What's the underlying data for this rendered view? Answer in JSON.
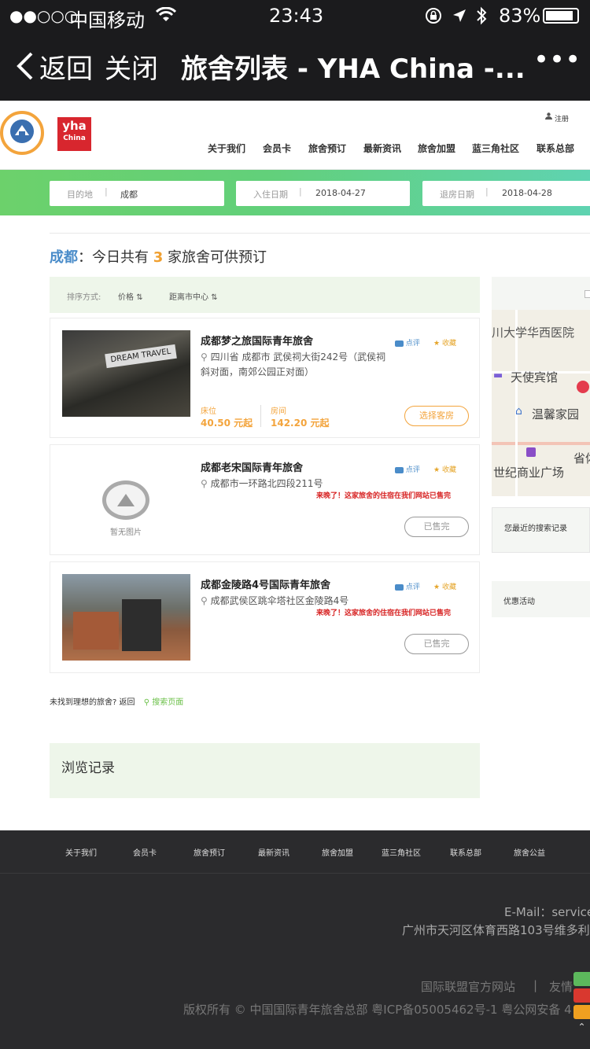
{
  "status": {
    "signal": "●●○○○",
    "carrier": "中国移动",
    "time": "23:43",
    "battery": "83%"
  },
  "nav": {
    "back": "返回",
    "close": "关闭",
    "title": "旅舍列表 - YHA China -...",
    "more": "•••"
  },
  "brand": {
    "logo_text": "yha",
    "logo_sub": "China",
    "register": "注册"
  },
  "menu": [
    "关于我们",
    "会员卡",
    "旅舍预订",
    "最新资讯",
    "旅舍加盟",
    "蓝三角社区",
    "联系总部"
  ],
  "search": {
    "dest_label": "目的地",
    "dest_value": "成都",
    "checkin_label": "入住日期",
    "checkin_value": "2018-04-27",
    "checkout_label": "退房日期",
    "checkout_value": "2018-04-28"
  },
  "summary": {
    "city": "成都",
    "prefix": "：今日共有",
    "count": "3",
    "suffix": "家旅舍可供预订"
  },
  "sort": {
    "label": "排序方式:",
    "price": "价格",
    "distance": "距离市中心"
  },
  "hostels": [
    {
      "name": "成都梦之旅国际青年旅舍",
      "address": "四川省 成都市 武侯祠大街242号（武侯祠斜对面，南郊公园正对面）",
      "review": "点评",
      "favorite": "收藏",
      "bed_label": "床位",
      "bed_price": "40.50 元起",
      "room_label": "房间",
      "room_price": "142.20 元起",
      "button": "选择客房"
    },
    {
      "name": "成都老宋国际青年旅舍",
      "address": "成都市一环路北四段211号",
      "review": "点评",
      "favorite": "收藏",
      "note": "来晚了！这家旅舍的住宿在我们网站已售完",
      "no_image": "暂无图片",
      "button": "已售完"
    },
    {
      "name": "成都金陵路4号国际青年旅舍",
      "address": "成都武侯区跳伞塔社区金陵路4号",
      "review": "点评",
      "favorite": "收藏",
      "note": "来晚了！这家旅舍的住宿在我们网站已售完",
      "button": "已售完"
    }
  ],
  "map_labels": [
    "川大学华西医院",
    "天使宾馆",
    "温馨家园",
    "世纪商业广场",
    "省体"
  ],
  "side": {
    "recent_search": "您最近的搜索记录",
    "promotion": "优惠活动"
  },
  "notfound": {
    "text": "未找到理想的旅舍? 返回",
    "link": "搜索页面"
  },
  "history_title": "浏览记录",
  "footer_menu": [
    "关于我们",
    "会员卡",
    "旅舍预订",
    "最新资讯",
    "旅舍加盟",
    "蓝三角社区",
    "联系总部",
    "旅舍公益"
  ],
  "footer": {
    "email": "E-Mail：service",
    "address": "广州市天河区体育西路103号维多利",
    "links": "国际联盟官方网站",
    "divider": "|",
    "friends": "友情",
    "copyright": "版权所有 © 中国国际青年旅舍总部  粤ICP备05005462号-1    粤公网安备 4"
  },
  "colors": {
    "accent_blue": "#4a8cc9",
    "accent_orange": "#f3a43c",
    "sold_red": "#d72222",
    "band_green": "#6cd16b"
  }
}
